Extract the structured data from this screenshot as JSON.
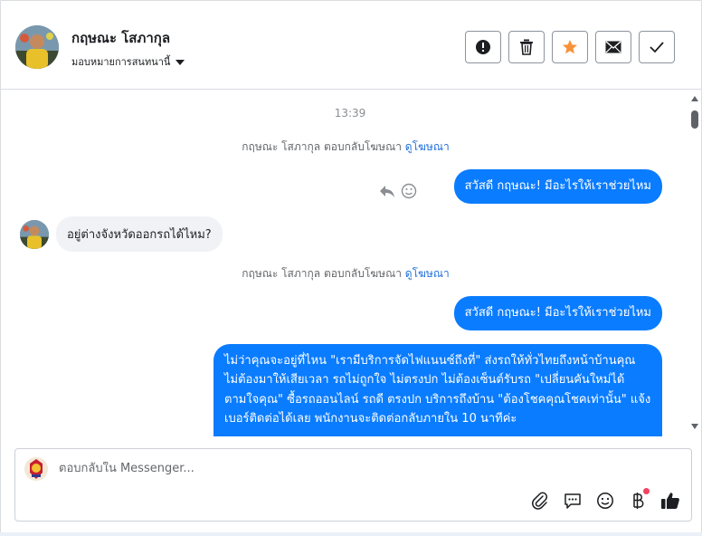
{
  "header": {
    "contact_name": "กฤษณะ โสภากุล",
    "assign_label": "มอบหมายการสนทนานี้",
    "actions": [
      {
        "icon": "alert-icon",
        "name": "spam-button"
      },
      {
        "icon": "trash-icon",
        "name": "delete-button"
      },
      {
        "icon": "star-icon",
        "name": "star-button"
      },
      {
        "icon": "envelope-icon",
        "name": "mark-unread-button"
      },
      {
        "icon": "check-icon",
        "name": "mark-done-button"
      }
    ],
    "star_color": "#f7923b"
  },
  "chat": {
    "timestamp": "13:39",
    "ad_note_1": {
      "text": "กฤษณะ โสภากุล ตอบกลับโฆษณา",
      "link": "ดูโฆษณา"
    },
    "msg_out_1": "สวัสดี กฤษณะ! มีอะไรให้เราช่วยไหม",
    "msg_in_1": "อยู่ต่างจังหวัดออกรถได้ไหม?",
    "ad_note_2": {
      "text": "กฤษณะ โสภากุล ตอบกลับโฆษณา",
      "link": "ดูโฆษณา"
    },
    "msg_out_2": "สวัสดี กฤษณะ! มีอะไรให้เราช่วยไหม",
    "msg_out_3": "ไม่ว่าคุณจะอยู่ที่ไหน \"เรามีบริการจัดไฟแนนซ์ถึงที่\" ส่งรถให้ทั่วไทยถึงหน้าบ้านคุณ ไม่ต้องมาให้เสียเวลา รถไม่ถูกใจ ไม่ตรงปก ไม่ต้องเซ็นต์รับรถ \"เปลี่ยนคันใหม่ได้ตามใจคุณ\" ซื้อรถออนไลน์ รถดี ตรงปก บริการถึงบ้าน \"ต้องโชคคุณโชคเท่านั้น\" แจ้งเบอร์ติดต่อได้เลย พนักงานจะติดต่อกลับภายใน 10 นาทีค่ะ",
    "bubble_color": "#0a7cff"
  },
  "composer": {
    "placeholder": "ตอบกลับใน Messenger...",
    "tools": [
      "paperclip-icon",
      "saved-reply-icon",
      "emoji-icon",
      "baht-icon",
      "thumbs-up-icon"
    ]
  }
}
